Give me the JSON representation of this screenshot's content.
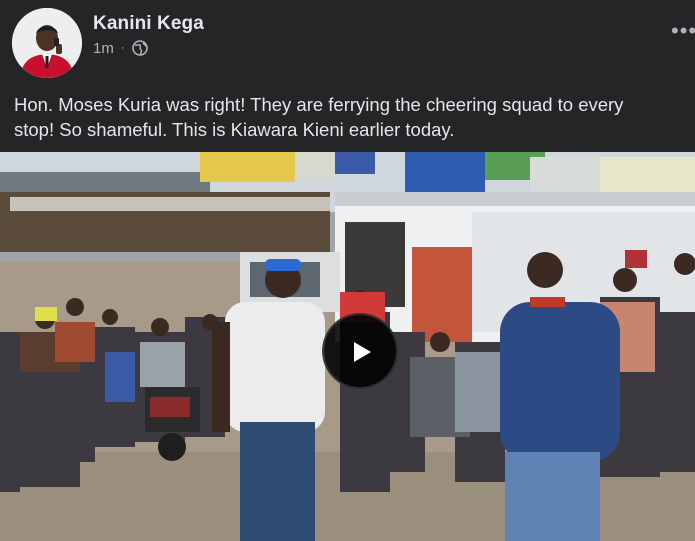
{
  "post": {
    "author": "Kanini Kega",
    "timestamp": "1m",
    "separator": "·",
    "audience_icon": "globe-icon",
    "more_icon": "more-dots-icon",
    "text_line1": "Hon. Moses Kuria was right! They are ferrying the cheering squad to every",
    "text_line2": "stop! So shameful. This is Kiawara Kieni earlier today.",
    "media": {
      "type": "video",
      "play_icon": "play-icon"
    }
  },
  "colors": {
    "background": "#242526",
    "primary_text": "#e4e6eb",
    "secondary_text": "#b0b3b8"
  }
}
